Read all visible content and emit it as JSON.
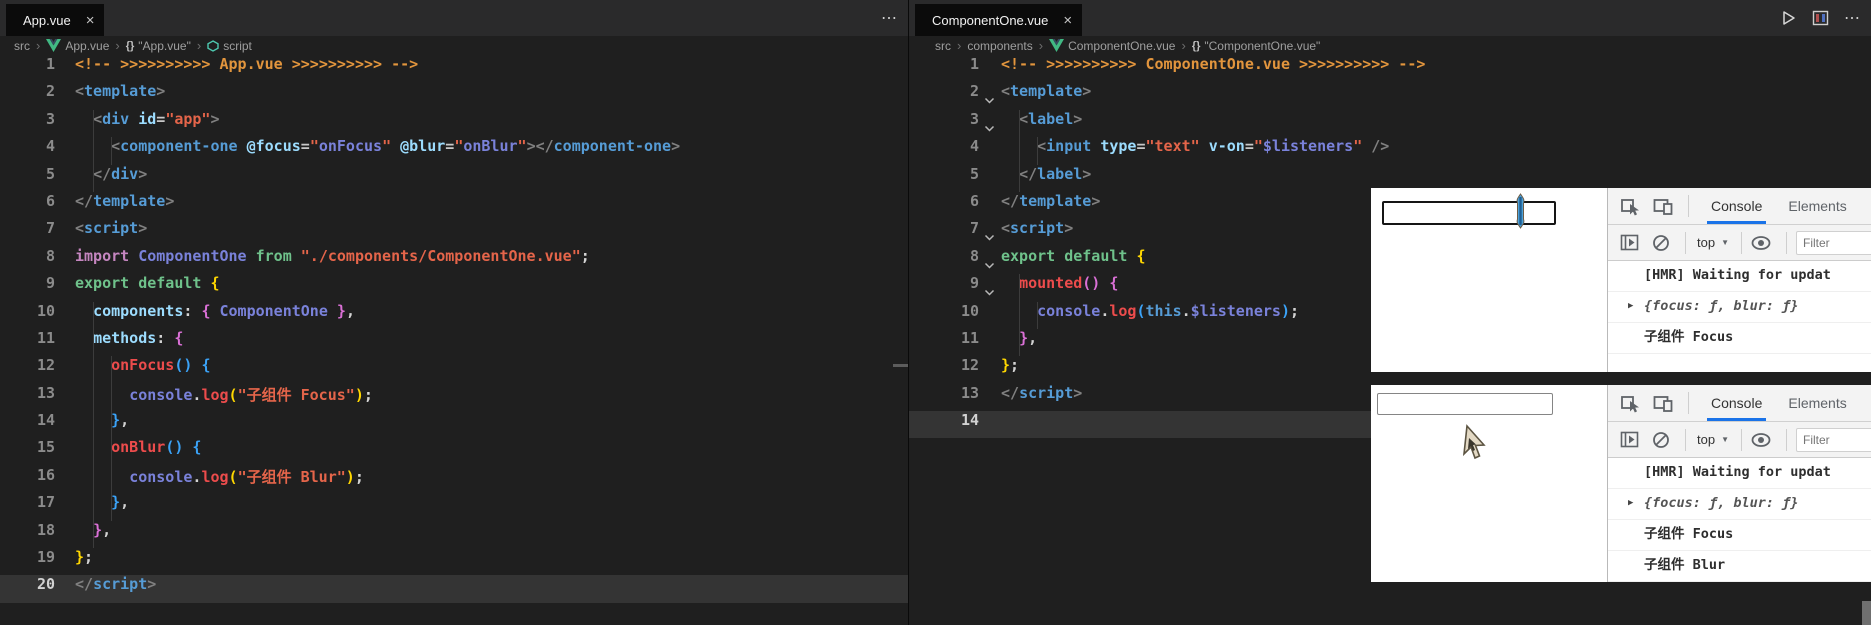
{
  "left_editor": {
    "tab": "App.vue",
    "close_label": "×",
    "more_actions": "⋯",
    "breadcrumb": [
      {
        "label": "src"
      },
      {
        "icon": "vue-icon",
        "label": "App.vue"
      },
      {
        "icon": "braces-icon",
        "label": "\"App.vue\""
      },
      {
        "icon": "module-icon",
        "label": "script"
      }
    ],
    "current_line": 20,
    "fold_lines": [],
    "lines": [
      [
        [
          "cm",
          "<!-- >>>>>>>>>> App.vue >>>>>>>>>> -->"
        ]
      ],
      [
        [
          "pn",
          "<"
        ],
        [
          "tg",
          "template"
        ],
        [
          "pn",
          ">"
        ]
      ],
      [
        [
          "tx",
          "  "
        ],
        [
          "pn",
          "<"
        ],
        [
          "tg",
          "div"
        ],
        [
          "tx",
          " "
        ],
        [
          "at",
          "id"
        ],
        [
          "eq",
          "="
        ],
        [
          "st",
          "\"app\""
        ],
        [
          "pn",
          ">"
        ]
      ],
      [
        [
          "tx",
          "    "
        ],
        [
          "pn",
          "<"
        ],
        [
          "tg",
          "component-one"
        ],
        [
          "tx",
          " "
        ],
        [
          "atb",
          "@focus"
        ],
        [
          "eq",
          "="
        ],
        [
          "st",
          "\""
        ],
        [
          "ex",
          "onFocus"
        ],
        [
          "st",
          "\""
        ],
        [
          "tx",
          " "
        ],
        [
          "atb",
          "@blur"
        ],
        [
          "eq",
          "="
        ],
        [
          "st",
          "\""
        ],
        [
          "ex",
          "onBlur"
        ],
        [
          "st",
          "\""
        ],
        [
          "pn",
          "></"
        ],
        [
          "tg",
          "component-one"
        ],
        [
          "pn",
          ">"
        ]
      ],
      [
        [
          "tx",
          "  "
        ],
        [
          "pn",
          "</"
        ],
        [
          "tg",
          "div"
        ],
        [
          "pn",
          ">"
        ]
      ],
      [
        [
          "pn",
          "</"
        ],
        [
          "tg",
          "template"
        ],
        [
          "pn",
          ">"
        ]
      ],
      [
        [
          "pn",
          "<"
        ],
        [
          "tg",
          "script"
        ],
        [
          "pn",
          ">"
        ]
      ],
      [
        [
          "k1",
          "import"
        ],
        [
          "tx",
          " "
        ],
        [
          "id",
          "ComponentOne"
        ],
        [
          "tx",
          " "
        ],
        [
          "k2",
          "from"
        ],
        [
          "tx",
          " "
        ],
        [
          "st",
          "\"./components/ComponentOne.vue\""
        ],
        [
          "tx",
          ";"
        ]
      ],
      [
        [
          "k2",
          "export"
        ],
        [
          "tx",
          " "
        ],
        [
          "k2",
          "default"
        ],
        [
          "tx",
          " "
        ],
        [
          "b1",
          "{"
        ]
      ],
      [
        [
          "tx",
          "  "
        ],
        [
          "pr",
          "components"
        ],
        [
          "tx",
          ": "
        ],
        [
          "b2",
          "{"
        ],
        [
          "tx",
          " "
        ],
        [
          "id",
          "ComponentOne"
        ],
        [
          "tx",
          " "
        ],
        [
          "b2",
          "}"
        ],
        [
          "tx",
          ","
        ]
      ],
      [
        [
          "tx",
          "  "
        ],
        [
          "pr",
          "methods"
        ],
        [
          "tx",
          ": "
        ],
        [
          "b2",
          "{"
        ]
      ],
      [
        [
          "tx",
          "    "
        ],
        [
          "fn",
          "onFocus"
        ],
        [
          "b3",
          "()"
        ],
        [
          "tx",
          " "
        ],
        [
          "b3",
          "{"
        ]
      ],
      [
        [
          "tx",
          "      "
        ],
        [
          "id",
          "console"
        ],
        [
          "tx",
          "."
        ],
        [
          "fn",
          "log"
        ],
        [
          "b1",
          "("
        ],
        [
          "st",
          "\"子组件 Focus\""
        ],
        [
          "b1",
          ")"
        ],
        [
          "tx",
          ";"
        ]
      ],
      [
        [
          "tx",
          "    "
        ],
        [
          "b3",
          "}"
        ],
        [
          "tx",
          ","
        ]
      ],
      [
        [
          "tx",
          "    "
        ],
        [
          "fn",
          "onBlur"
        ],
        [
          "b3",
          "()"
        ],
        [
          "tx",
          " "
        ],
        [
          "b3",
          "{"
        ]
      ],
      [
        [
          "tx",
          "      "
        ],
        [
          "id",
          "console"
        ],
        [
          "tx",
          "."
        ],
        [
          "fn",
          "log"
        ],
        [
          "b1",
          "("
        ],
        [
          "st",
          "\"子组件 Blur\""
        ],
        [
          "b1",
          ")"
        ],
        [
          "tx",
          ";"
        ]
      ],
      [
        [
          "tx",
          "    "
        ],
        [
          "b3",
          "}"
        ],
        [
          "tx",
          ","
        ]
      ],
      [
        [
          "tx",
          "  "
        ],
        [
          "b2",
          "}"
        ],
        [
          "tx",
          ","
        ]
      ],
      [
        [
          "b1",
          "}"
        ],
        [
          "tx",
          ";"
        ]
      ],
      [
        [
          "pn",
          "</"
        ],
        [
          "tg",
          "script"
        ],
        [
          "pn",
          ">"
        ]
      ]
    ]
  },
  "right_editor": {
    "tab": "ComponentOne.vue",
    "close_label": "×",
    "more_actions": "⋯",
    "action_icons": [
      "run-icon",
      "split-editor-icon",
      "more-actions-icon"
    ],
    "breadcrumb": [
      {
        "label": "src"
      },
      {
        "label": "components"
      },
      {
        "icon": "vue-icon",
        "label": "ComponentOne.vue"
      },
      {
        "icon": "braces-icon",
        "label": "\"ComponentOne.vue\""
      }
    ],
    "current_line": 14,
    "fold_lines": [
      2,
      3,
      7,
      8,
      9
    ],
    "lines": [
      [
        [
          "cm",
          "<!-- >>>>>>>>>> ComponentOne.vue >>>>>>>>>> -->"
        ]
      ],
      [
        [
          "pn",
          "<"
        ],
        [
          "tg",
          "template"
        ],
        [
          "pn",
          ">"
        ]
      ],
      [
        [
          "tx",
          "  "
        ],
        [
          "pn",
          "<"
        ],
        [
          "tg",
          "label"
        ],
        [
          "pn",
          ">"
        ]
      ],
      [
        [
          "tx",
          "    "
        ],
        [
          "pn",
          "<"
        ],
        [
          "tg",
          "input"
        ],
        [
          "tx",
          " "
        ],
        [
          "at",
          "type"
        ],
        [
          "eq",
          "="
        ],
        [
          "st",
          "\"text\""
        ],
        [
          "tx",
          " "
        ],
        [
          "atb",
          "v-on"
        ],
        [
          "eq",
          "="
        ],
        [
          "st",
          "\""
        ],
        [
          "ex",
          "$listeners"
        ],
        [
          "st",
          "\""
        ],
        [
          "tx",
          " "
        ],
        [
          "pn",
          "/>"
        ]
      ],
      [
        [
          "tx",
          "  "
        ],
        [
          "pn",
          "</"
        ],
        [
          "tg",
          "label"
        ],
        [
          "pn",
          ">"
        ]
      ],
      [
        [
          "pn",
          "</"
        ],
        [
          "tg",
          "template"
        ],
        [
          "pn",
          ">"
        ]
      ],
      [
        [
          "pn",
          "<"
        ],
        [
          "tg",
          "script"
        ],
        [
          "pn",
          ">"
        ]
      ],
      [
        [
          "k2",
          "export"
        ],
        [
          "tx",
          " "
        ],
        [
          "k2",
          "default"
        ],
        [
          "tx",
          " "
        ],
        [
          "b1",
          "{"
        ]
      ],
      [
        [
          "tx",
          "  "
        ],
        [
          "fn",
          "mounted"
        ],
        [
          "b2",
          "()"
        ],
        [
          "tx",
          " "
        ],
        [
          "b2",
          "{"
        ]
      ],
      [
        [
          "tx",
          "    "
        ],
        [
          "id",
          "console"
        ],
        [
          "tx",
          "."
        ],
        [
          "fn",
          "log"
        ],
        [
          "b3",
          "("
        ],
        [
          "th",
          "this"
        ],
        [
          "tx",
          "."
        ],
        [
          "ex",
          "$listeners"
        ],
        [
          "b3",
          ")"
        ],
        [
          "tx",
          ";"
        ]
      ],
      [
        [
          "tx",
          "  "
        ],
        [
          "b2",
          "}"
        ],
        [
          "tx",
          ","
        ]
      ],
      [
        [
          "b1",
          "}"
        ],
        [
          "tx",
          ";"
        ]
      ],
      [
        [
          "pn",
          "</"
        ],
        [
          "tg",
          "script"
        ],
        [
          "pn",
          ">"
        ]
      ],
      []
    ]
  },
  "devtools": {
    "tabs": [
      "Console",
      "Elements"
    ],
    "selected_tab": "Console",
    "context_selector": "top",
    "filter_placeholder": "Filter",
    "toolbar_icons": [
      "inspect-icon",
      "device-toolbar-icon"
    ],
    "bar_icons": [
      "dock-sidebar-icon",
      "clear-console-icon"
    ],
    "eye_icon": "live-expression-eye-icon",
    "accent_color": "#1a73e8"
  },
  "panels": [
    {
      "input_value": "",
      "input_focused": true,
      "cursor_icon": "text-cursor-icon",
      "console_rows": [
        {
          "kind": "log",
          "text": "[HMR] Waiting for updat"
        },
        {
          "kind": "object",
          "text": "{focus: ƒ, blur: ƒ}",
          "expander": "▶"
        },
        {
          "kind": "log",
          "text": "子组件 Focus"
        }
      ]
    },
    {
      "input_value": "",
      "input_focused": false,
      "cursor_icon": "arrow-cursor-icon",
      "console_rows": [
        {
          "kind": "log",
          "text": "[HMR] Waiting for updat"
        },
        {
          "kind": "object",
          "text": "{focus: ƒ, blur: ƒ}",
          "expander": "▶"
        },
        {
          "kind": "log",
          "text": "子组件 Focus"
        },
        {
          "kind": "log",
          "text": "子组件 Blur"
        }
      ]
    }
  ]
}
